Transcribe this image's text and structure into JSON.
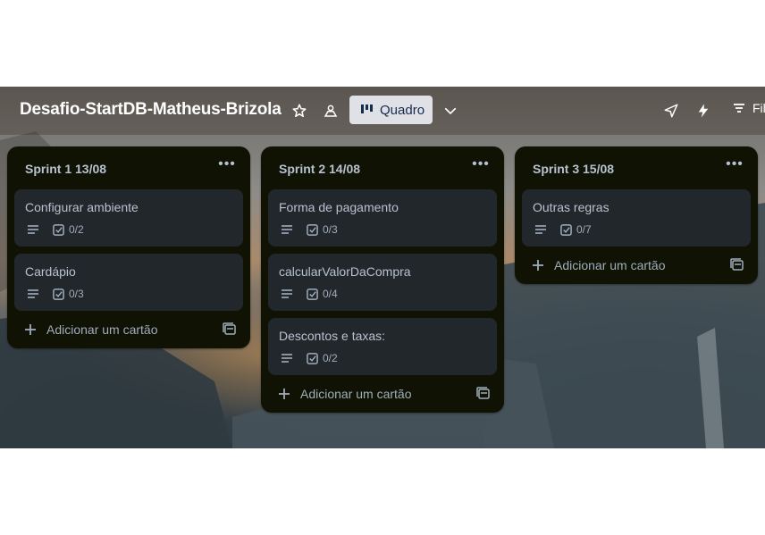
{
  "board": {
    "title": "Desafio-StartDB-Matheus-Brizola",
    "view_label": "Quadro",
    "filter_label": "Fil"
  },
  "lists": [
    {
      "title": "Sprint 1 13/08",
      "cards": [
        {
          "title": "Configurar ambiente",
          "checklist": "0/2"
        },
        {
          "title": "Cardápio",
          "checklist": "0/3"
        }
      ],
      "add_label": "Adicionar um cartão"
    },
    {
      "title": "Sprint 2 14/08",
      "cards": [
        {
          "title": "Forma de pagamento",
          "checklist": "0/3"
        },
        {
          "title": "calcularValorDaCompra",
          "checklist": "0/4"
        },
        {
          "title": "Descontos e taxas:",
          "checklist": "0/2"
        }
      ],
      "add_label": "Adicionar um cartão"
    },
    {
      "title": "Sprint 3 15/08",
      "cards": [
        {
          "title": "Outras regras",
          "checklist": "0/7"
        }
      ],
      "add_label": "Adicionar um cartão"
    }
  ],
  "icons": {
    "star": "star-icon",
    "workspace_visibility": "people-icon",
    "board_view": "board-view-icon",
    "view_switcher": "chevron-down-icon",
    "send": "send-icon",
    "automation": "lightning-icon",
    "filter": "filter-icon",
    "list_menu": "more-dots-icon",
    "description": "description-icon",
    "checklist": "checkbox-icon",
    "add": "plus-icon",
    "template": "template-icon"
  },
  "colors": {
    "list_bg": "#101204",
    "card_bg": "#22272b",
    "text": "#b6c2cf",
    "view_button_bg": "#dfe1e6"
  }
}
